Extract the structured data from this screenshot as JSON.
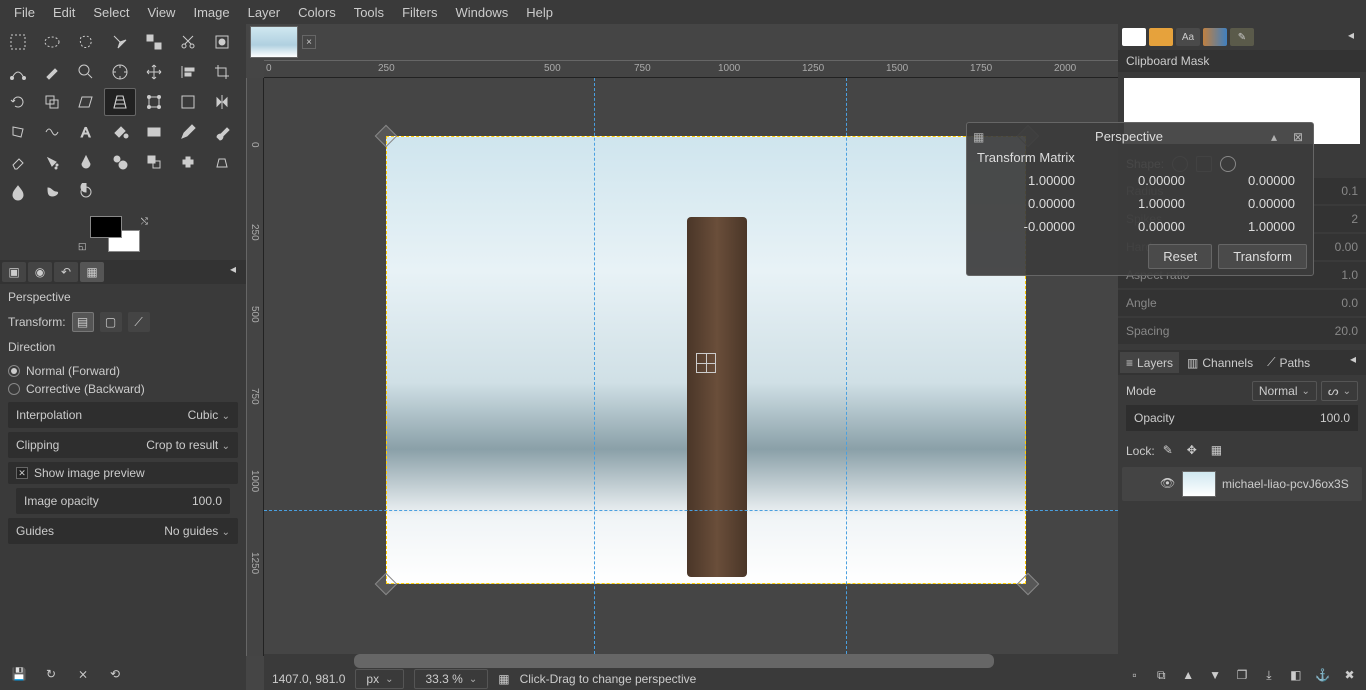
{
  "menu": [
    "File",
    "Edit",
    "Select",
    "View",
    "Image",
    "Layer",
    "Colors",
    "Tools",
    "Filters",
    "Windows",
    "Help"
  ],
  "tool_options": {
    "title": "Perspective",
    "transform_label": "Transform:",
    "direction_label": "Direction",
    "direction_normal": "Normal (Forward)",
    "direction_corrective": "Corrective (Backward)",
    "interpolation_label": "Interpolation",
    "interpolation_value": "Cubic",
    "clipping_label": "Clipping",
    "clipping_value": "Crop to result",
    "preview_label": "Show image preview",
    "opacity_label": "Image opacity",
    "opacity_value": "100.0",
    "guides_label": "Guides",
    "guides_value": "No guides"
  },
  "ruler_h": [
    "0",
    "250",
    "500",
    "750",
    "1000",
    "1250",
    "1500",
    "1750",
    "2000"
  ],
  "ruler_v": [
    "0",
    "250",
    "500",
    "750",
    "1000",
    "1250"
  ],
  "dialog": {
    "title": "Perspective",
    "subtitle": "Transform Matrix",
    "matrix": [
      "1.00000",
      "0.00000",
      "0.00000",
      "0.00000",
      "1.00000",
      "0.00000",
      "-0.00000",
      "0.00000",
      "1.00000"
    ],
    "reset": "Reset",
    "transform": "Transform"
  },
  "status": {
    "coords": "1407.0, 981.0",
    "unit": "px",
    "zoom": "33.3 %",
    "hint": "Click-Drag to change perspective"
  },
  "right": {
    "clipboard_label": "Clipboard Mask",
    "shape_label": "Shape:",
    "sliders": [
      {
        "label": "Radius",
        "value": "0.1"
      },
      {
        "label": "Spikes",
        "value": "2"
      },
      {
        "label": "Hardness",
        "value": "0.00"
      },
      {
        "label": "Aspect ratio",
        "value": "1.0"
      },
      {
        "label": "Angle",
        "value": "0.0"
      },
      {
        "label": "Spacing",
        "value": "20.0"
      }
    ],
    "layers_tab": "Layers",
    "channels_tab": "Channels",
    "paths_tab": "Paths",
    "mode_label": "Mode",
    "mode_value": "Normal",
    "opacity_label": "Opacity",
    "opacity_value": "100.0",
    "lock_label": "Lock:",
    "layer_name": "michael-liao-pcvJ6ox3S"
  }
}
